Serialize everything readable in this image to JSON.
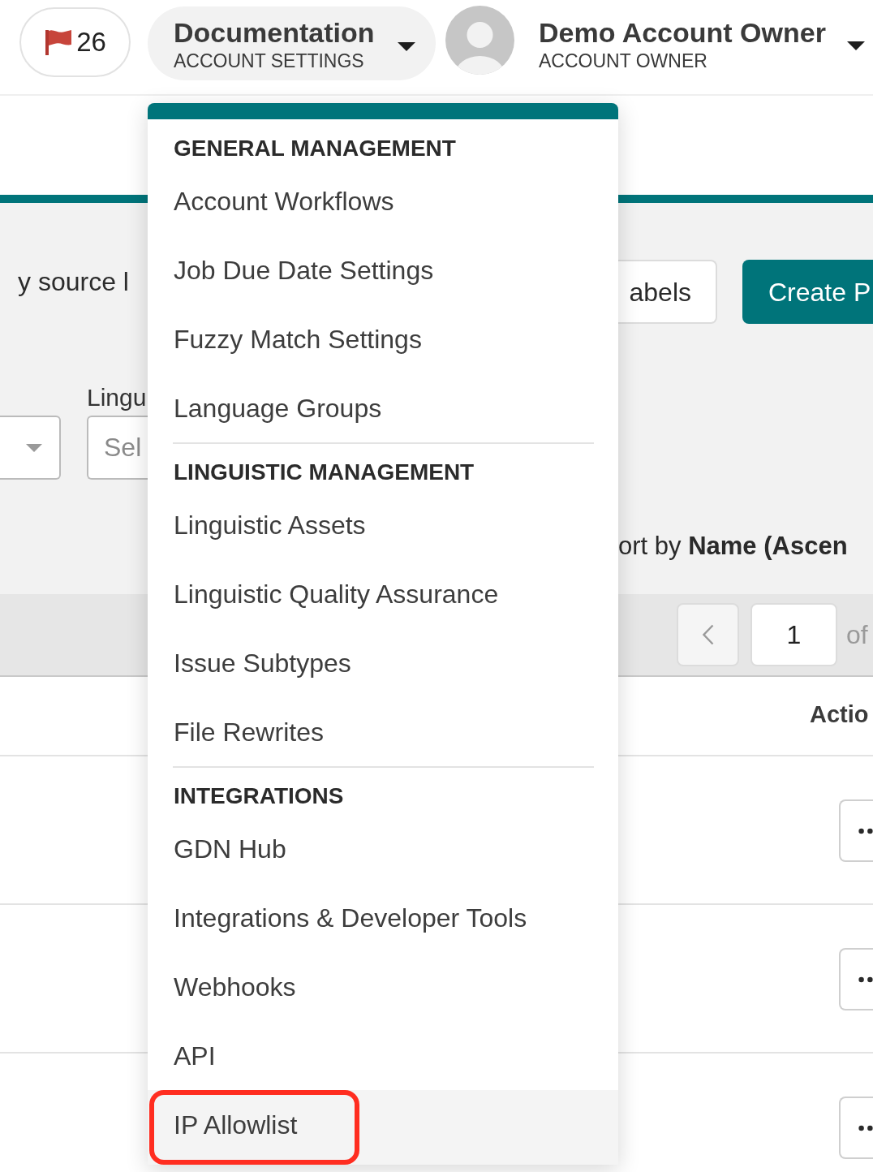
{
  "header": {
    "flags": {
      "count": "26"
    },
    "workspace": {
      "name": "Documentation",
      "subtitle": "ACCOUNT SETTINGS"
    },
    "user": {
      "name": "Demo Account Owner",
      "role": "ACCOUNT OWNER"
    }
  },
  "page": {
    "filter_text": "y source l",
    "filters": [
      {
        "kind": "dropdown"
      },
      {
        "kind": "text",
        "label": "Lingu",
        "placeholder": "Sel"
      }
    ],
    "buttons": [
      {
        "label": "abels",
        "kind": "outline"
      },
      {
        "label": "Create P",
        "kind": "primary"
      }
    ],
    "sort_text": "ort by **Name (Ascen**",
    "pagination": {
      "page": "1",
      "of_text": "of"
    },
    "table": {
      "columns": [
        {
          "label": "Actio"
        }
      ],
      "rows": [
        {
          "kind": "actions"
        },
        {
          "kind": "actions"
        },
        {
          "kind": "actions"
        }
      ]
    }
  },
  "dropdown": {
    "sections": [
      {
        "heading": "GENERAL MANAGEMENT",
        "items": [
          {
            "label": "Account Workflows",
            "selected": false,
            "circled": false
          },
          {
            "label": "Job Due Date Settings",
            "selected": false,
            "circled": false
          },
          {
            "label": "Fuzzy Match Settings",
            "selected": false,
            "circled": false
          },
          {
            "label": "Language Groups",
            "selected": false,
            "circled": false
          }
        ]
      },
      {
        "heading": "LINGUISTIC MANAGEMENT",
        "items": [
          {
            "label": "Linguistic Assets",
            "selected": false,
            "circled": false
          },
          {
            "label": "Linguistic Quality Assurance",
            "selected": false,
            "circled": false
          },
          {
            "label": "Issue Subtypes",
            "selected": false,
            "circled": false
          },
          {
            "label": "File Rewrites",
            "selected": false,
            "circled": false
          }
        ]
      },
      {
        "heading": "INTEGRATIONS",
        "items": [
          {
            "label": "GDN Hub",
            "selected": false,
            "circled": false
          },
          {
            "label": "Integrations & Developer Tools",
            "selected": false,
            "circled": false
          },
          {
            "label": "Webhooks",
            "selected": false,
            "circled": false
          },
          {
            "label": "API",
            "selected": false,
            "circled": false
          },
          {
            "label": "IP Allowlist",
            "selected": true,
            "circled": true
          }
        ]
      }
    ]
  }
}
